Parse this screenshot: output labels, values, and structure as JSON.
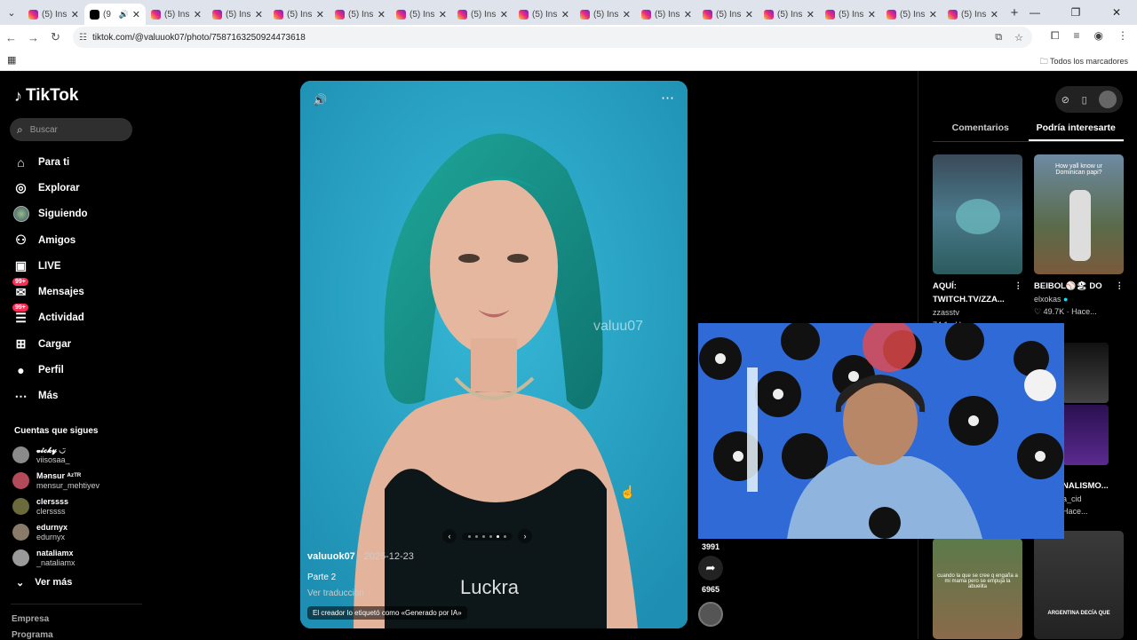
{
  "browser": {
    "tabs": [
      {
        "label": "(5) Ins",
        "type": "instagram"
      },
      {
        "label": "(9",
        "type": "tiktok",
        "active": true
      },
      {
        "label": "(5) Ins",
        "type": "instagram"
      },
      {
        "label": "(5) Ins",
        "type": "instagram"
      },
      {
        "label": "(5) Ins",
        "type": "instagram"
      },
      {
        "label": "(5) Ins",
        "type": "instagram"
      },
      {
        "label": "(5) Ins",
        "type": "instagram"
      },
      {
        "label": "(5) Ins",
        "type": "instagram"
      },
      {
        "label": "(5) Ins",
        "type": "instagram"
      },
      {
        "label": "(5) Ins",
        "type": "instagram"
      },
      {
        "label": "(5) Ins",
        "type": "instagram"
      },
      {
        "label": "(5) Ins",
        "type": "instagram"
      },
      {
        "label": "(5) Ins",
        "type": "instagram"
      },
      {
        "label": "(5) Ins",
        "type": "instagram"
      },
      {
        "label": "(5) Ins",
        "type": "instagram"
      },
      {
        "label": "(5) Ins",
        "type": "instagram"
      }
    ],
    "url": "tiktok.com/@valuuok07/photo/7587163250924473618",
    "bookmarks_all": "Todos los marcadores"
  },
  "sidebar": {
    "logo": "TikTok",
    "search_placeholder": "Buscar",
    "nav": [
      {
        "label": "Para ti",
        "icon": "home-icon"
      },
      {
        "label": "Explorar",
        "icon": "compass-icon"
      },
      {
        "label": "Siguiendo",
        "icon": "following-avatar-icon"
      },
      {
        "label": "Amigos",
        "icon": "friends-icon"
      },
      {
        "label": "LIVE",
        "icon": "live-icon"
      },
      {
        "label": "Mensajes",
        "icon": "messages-icon",
        "badge": "99+"
      },
      {
        "label": "Actividad",
        "icon": "activity-icon",
        "badge": "99+"
      },
      {
        "label": "Cargar",
        "icon": "upload-icon"
      },
      {
        "label": "Perfil",
        "icon": "profile-icon"
      },
      {
        "label": "Más",
        "icon": "more-icon"
      }
    ],
    "following_header": "Cuentas que sigues",
    "following": [
      {
        "name": "𝓿𝓲𝓬𝓴𝔂 ◡̈",
        "user": "viisosaa_"
      },
      {
        "name": "Mənsur ᴬᶻᵀᴿ",
        "user": "mensur_mehtiyev"
      },
      {
        "name": "clerssss",
        "user": "clerssss"
      },
      {
        "name": "edurnyx",
        "user": "edurnyx"
      },
      {
        "name": "nataliamx",
        "user": "_nataliamx"
      }
    ],
    "see_more": "Ver más",
    "footer_company": "Empresa",
    "footer_program": "Programa"
  },
  "post": {
    "watermark": "valuu07",
    "author": "valuuok07",
    "date": " · 2025-12-23",
    "text": "Parte 2",
    "translate": "Ver traducción",
    "caption_overlay": "Luckra",
    "ai_label": "El creador lo etiquetó como «Generado por IA»",
    "carousel_total": 6,
    "carousel_active": 5,
    "shares": "3991",
    "saves": "6965"
  },
  "right_panel": {
    "tabs": [
      "Comentarios",
      "Podría interesarte"
    ],
    "active_tab": "Podría interesarte",
    "cards": [
      {
        "title": "AQUÍ: TWITCH.TV/ZZA...",
        "user": "zzasstv",
        "stats": "74.1 · Hace"
      },
      {
        "title": "BEIBOL⚾️🏖 DO",
        "user": "elxokas",
        "stats": "49.7K · Hace..."
      },
      {
        "title": "NALISMO...",
        "user": "a_cid",
        "stats": "Hace..."
      }
    ],
    "thumb_texts": [
      "How yall know ur Dominican papi?",
      "cuando la que se cree q engaña a mi mama pero se empuja la abuelita",
      "ARGENTINA DECÍA QUE"
    ]
  }
}
